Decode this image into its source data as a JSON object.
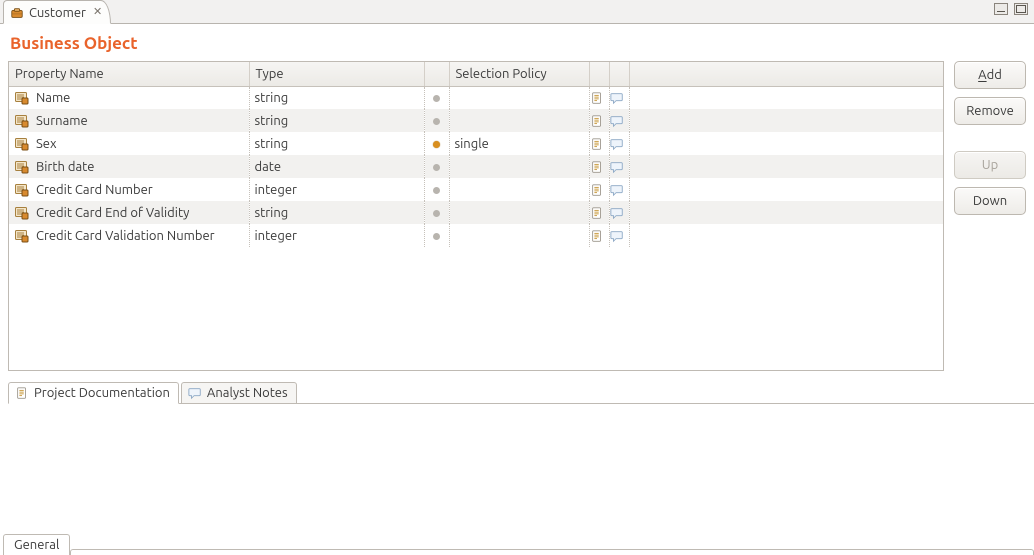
{
  "tab": {
    "title": "Customer"
  },
  "heading": "Business Object",
  "columns": {
    "name": "Property Name",
    "type": "Type",
    "selection": "Selection Policy"
  },
  "rows": [
    {
      "name": "Name",
      "type": "string",
      "required_strong": false,
      "selection": ""
    },
    {
      "name": "Surname",
      "type": "string",
      "required_strong": false,
      "selection": ""
    },
    {
      "name": "Sex",
      "type": "string",
      "required_strong": true,
      "selection": "single"
    },
    {
      "name": "Birth date",
      "type": "date",
      "required_strong": false,
      "selection": ""
    },
    {
      "name": "Credit Card Number",
      "type": "integer",
      "required_strong": false,
      "selection": ""
    },
    {
      "name": "Credit Card End of Validity",
      "type": "string",
      "required_strong": false,
      "selection": ""
    },
    {
      "name": "Credit Card Validation Number",
      "type": "integer",
      "required_strong": false,
      "selection": ""
    }
  ],
  "buttons": {
    "add": {
      "label": "Add",
      "enabled": true,
      "mnemonic": "A"
    },
    "remove": {
      "label": "Remove",
      "enabled": true,
      "mnemonic": ""
    },
    "up": {
      "label": "Up",
      "enabled": false,
      "mnemonic": ""
    },
    "down": {
      "label": "Down",
      "enabled": true,
      "mnemonic": ""
    }
  },
  "doc_tabs": [
    {
      "label": "Project Documentation",
      "active": true,
      "icon": "doc"
    },
    {
      "label": "Analyst Notes",
      "active": false,
      "icon": "note"
    }
  ],
  "page_tabs": [
    {
      "label": "General",
      "active": true
    }
  ]
}
